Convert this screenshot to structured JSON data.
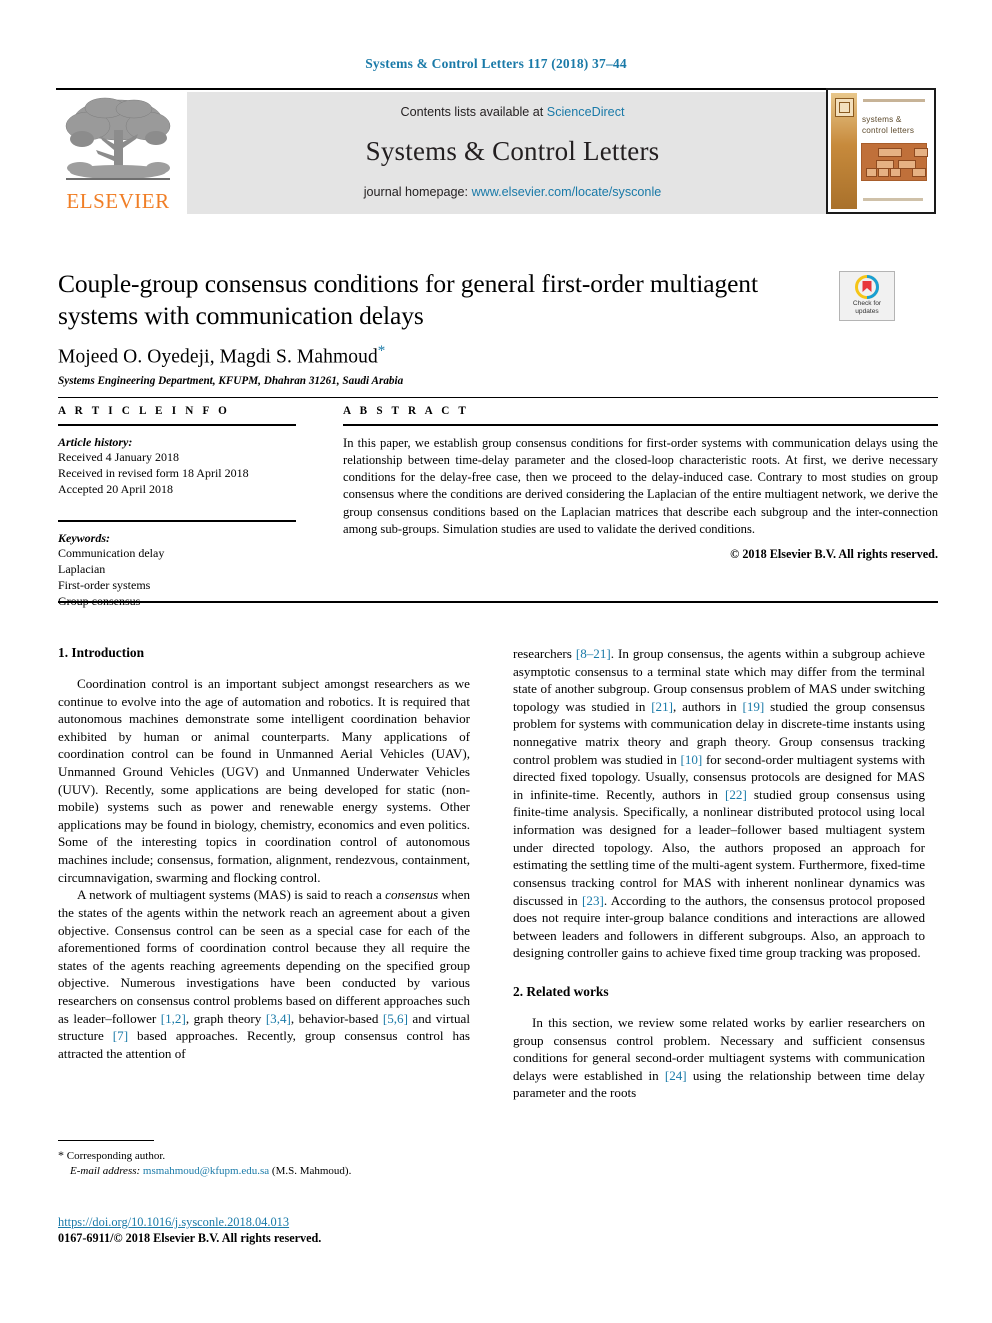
{
  "running_head": "Systems & Control Letters 117 (2018) 37–44",
  "masthead": {
    "contents_prefix": "Contents lists available at ",
    "sciencedirect_link": "ScienceDirect",
    "journal_title": "Systems & Control Letters",
    "homepage_prefix": "journal homepage: ",
    "homepage_link": "www.elsevier.com/locate/sysconle",
    "publisher_logo_text": "ELSEVIER",
    "cover": {
      "title_line1": "systems &",
      "title_line2": "control letters"
    }
  },
  "article": {
    "title": "Couple-group consensus conditions for general first-order multiagent systems with communication delays",
    "authors": "Mojeed O. Oyedeji, Magdi S. Mahmoud",
    "corresponding_marker": "*",
    "affiliation": "Systems Engineering Department, KFUPM, Dhahran 31261, Saudi Arabia"
  },
  "crossmark": {
    "line1": "Check for",
    "line2": "updates"
  },
  "article_info": {
    "heading": "A R T I C L E   I N F O",
    "history_label": "Article history:",
    "history": [
      "Received 4 January 2018",
      "Received in revised form 18 April 2018",
      "Accepted 20 April 2018"
    ],
    "keywords_label": "Keywords:",
    "keywords": [
      "Communication delay",
      "Laplacian",
      "First-order systems",
      "Group consensus"
    ]
  },
  "abstract": {
    "heading": "A B S T R A C T",
    "text": "In this paper, we establish group consensus conditions for first-order systems with communication delays using the relationship between time-delay parameter and the closed-loop characteristic roots. At first, we derive necessary conditions for the delay-free case, then we proceed to the delay-induced case. Contrary to most studies on group consensus where the conditions are derived considering the Laplacian of the entire multiagent network, we derive the group consensus conditions based on the Laplacian matrices that describe each subgroup and the inter-connection among sub-groups. Simulation studies are used to validate the derived conditions.",
    "copyright": "© 2018 Elsevier B.V. All rights reserved."
  },
  "body": {
    "section1_heading": "1. Introduction",
    "section2_heading": "2. Related works",
    "left_p1": "Coordination control is an important subject amongst researchers as we continue to evolve into the age of automation and robotics. It is required that autonomous machines demonstrate some intelligent coordination behavior exhibited by human or animal counterparts. Many applications of coordination control can be found in Unmanned Aerial Vehicles (UAV), Unmanned Ground Vehicles (UGV) and Unmanned Underwater Vehicles (UUV). Recently, some applications are being developed for static (non-mobile) systems such as power and renewable energy systems. Other applications may be found in biology, chemistry, economics and even politics. Some of the interesting topics in coordination control of autonomous machines include; consensus, formation, alignment, rendezvous, containment, circumnavigation, swarming and flocking control.",
    "left_p2_a": "A network of multiagent systems (MAS) is said to reach a ",
    "left_p2_italic": "consensus",
    "left_p2_b": " when the states of the agents within the network reach an agreement about a given objective. Consensus control can be seen as a special case for each of the aforementioned forms of coordination control because they all require the states of the agents reaching agreements depending on the specified group objective. Numerous investigations have been conducted by various researchers on consensus control problems based on different approaches such as leader–follower ",
    "left_p2_cite1": "[1,2]",
    "left_p2_c": ", graph theory ",
    "left_p2_cite2": "[3,4]",
    "left_p2_d": ", behavior-based ",
    "left_p2_cite3": "[5,6]",
    "left_p2_e": " and virtual structure ",
    "left_p2_cite4": "[7]",
    "left_p2_f": " based approaches. Recently, group consensus control has attracted the attention of",
    "right_p1_a": "researchers ",
    "right_p1_cite1": "[8–21]",
    "right_p1_b": ". In group consensus, the agents within a subgroup achieve asymptotic consensus to a terminal state which may differ from the terminal state of another subgroup. Group consensus problem of MAS under switching topology was studied in ",
    "right_p1_cite2": "[21]",
    "right_p1_c": ", authors in ",
    "right_p1_cite3": "[19]",
    "right_p1_d": " studied the group consensus problem for systems with communication delay in discrete-time instants using nonnegative matrix theory and graph theory. Group consensus tracking control problem was studied in ",
    "right_p1_cite4": "[10]",
    "right_p1_e": " for second-order multiagent systems with directed fixed topology. Usually, consensus protocols are designed for MAS in infinite-time. Recently, authors in ",
    "right_p1_cite5": "[22]",
    "right_p1_f": " studied group consensus using finite-time analysis. Specifically, a nonlinear distributed protocol using local information was designed for a leader–follower based multiagent system under directed topology. Also, the authors proposed an approach for estimating the settling time of the multi-agent system. Furthermore, fixed-time consensus tracking control for MAS with inherent nonlinear dynamics was discussed in ",
    "right_p1_cite6": "[23]",
    "right_p1_g": ". According to the authors, the consensus protocol proposed does not require inter-group balance conditions and interactions are allowed between leaders and followers in different subgroups. Also, an approach to designing controller gains to achieve fixed time group tracking was proposed.",
    "right_p2_a": "In this section, we review some related works by earlier researchers on group consensus control problem. Necessary and sufficient consensus conditions for general second-order multiagent systems with communication delays were established in ",
    "right_p2_cite1": "[24]",
    "right_p2_b": " using the relationship between time delay parameter and the roots"
  },
  "footnote": {
    "star": "*",
    "corresponding": " Corresponding author.",
    "email_label": "E-mail address:",
    "email": "msmahmoud@kfupm.edu.sa",
    "email_suffix": " (M.S. Mahmoud)."
  },
  "footer": {
    "doi": "https://doi.org/10.1016/j.sysconle.2018.04.013",
    "issn_line": "0167-6911/© 2018 Elsevier B.V. All rights reserved."
  },
  "colors": {
    "link": "#1a7aa8",
    "elsevier_orange": "#f07e26",
    "masthead_grey": "#e4e4e4"
  }
}
